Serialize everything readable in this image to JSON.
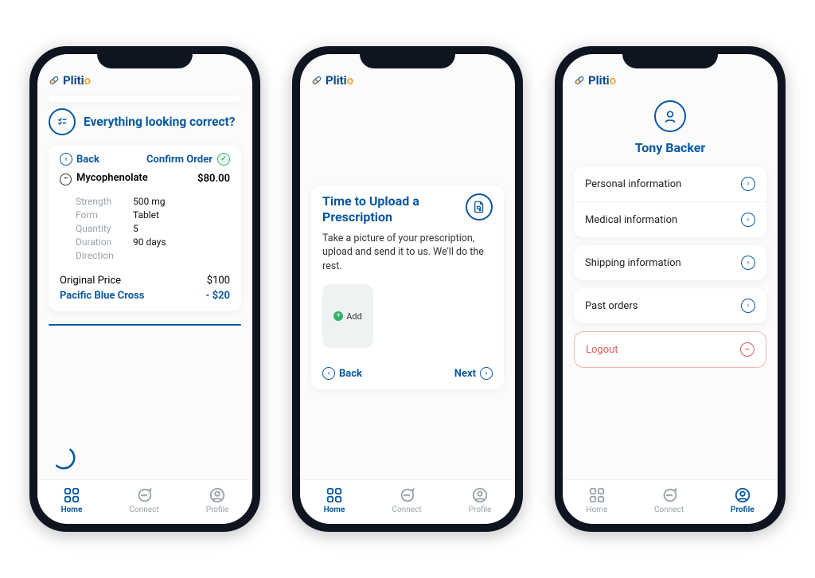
{
  "brand": {
    "a": "Pliti",
    "b": "o"
  },
  "nav": {
    "home": "Home",
    "connect": "Connect",
    "profile": "Profile"
  },
  "screen1": {
    "heading": "Everything looking correct?",
    "back": "Back",
    "confirm": "Confirm Order",
    "med_name": "Mycophenolate",
    "med_price": "$80.00",
    "labels": {
      "strength": "Strength",
      "form": "Form",
      "qty": "Quantity",
      "dur": "Duration",
      "dir": "Direction"
    },
    "values": {
      "strength": "500 mg",
      "form": "Tablet",
      "qty": "5",
      "dur": "90 days",
      "dir": ""
    },
    "orig_label": "Original Price",
    "orig_value": "$100",
    "insurer": "Pacific Blue Cross",
    "discount": "- $20"
  },
  "screen2": {
    "title": "Time to Upload a Prescription",
    "sub": "Take a picture of your prescription, upload and send it to us. We'll do the rest.",
    "add": "Add",
    "back": "Back",
    "next": "Next"
  },
  "screen3": {
    "name": "Tony Backer",
    "items": {
      "personal": "Personal information",
      "medical": "Medical information",
      "shipping": "Shipping information",
      "orders": "Past orders"
    },
    "logout": "Logout"
  }
}
